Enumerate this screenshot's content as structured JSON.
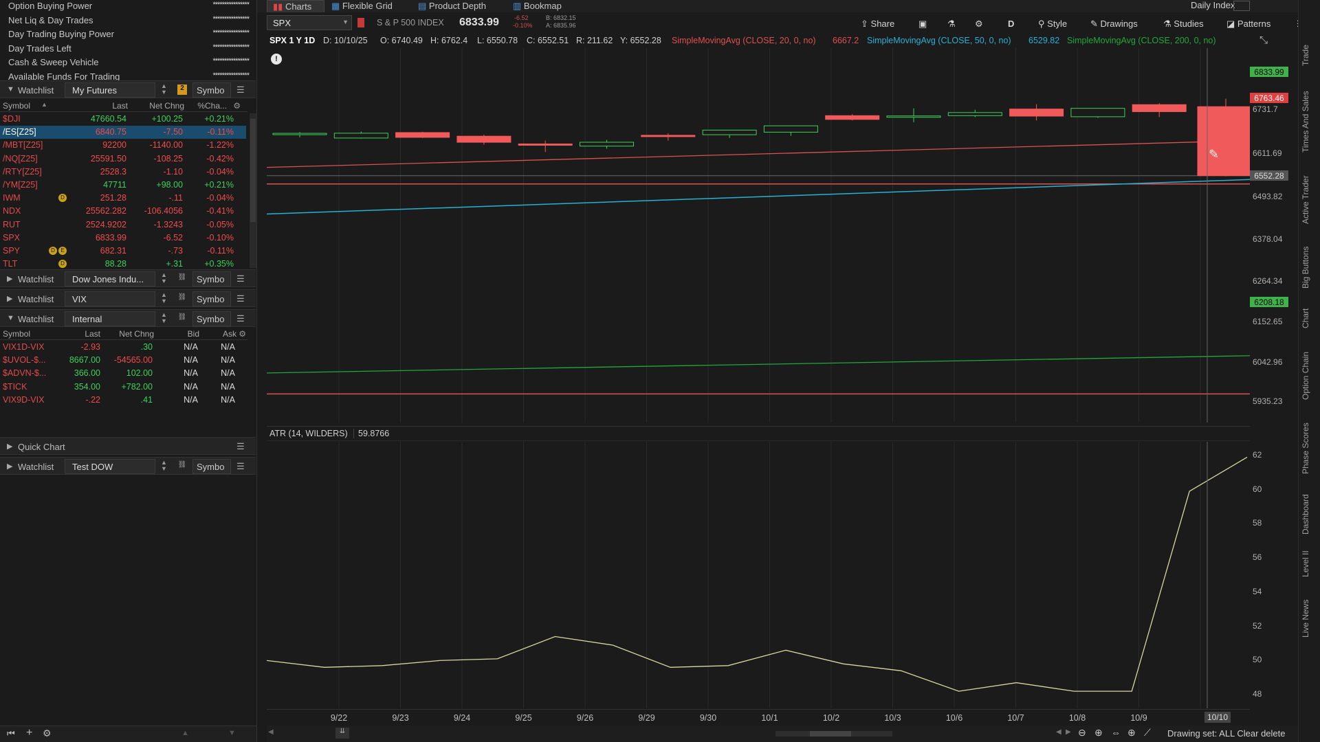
{
  "account": [
    {
      "label": "Option Buying Power",
      "value": "****************"
    },
    {
      "label": "Net Liq & Day Trades",
      "value": "****************"
    },
    {
      "label": "Day Trading Buying Power",
      "value": "****************"
    },
    {
      "label": "Day Trades Left",
      "value": "****************"
    },
    {
      "label": "Cash & Sweep Vehicle",
      "value": "****************"
    },
    {
      "label": "Available Funds For Trading",
      "value": "****************"
    }
  ],
  "wl1": {
    "title": "Watchlist",
    "name": "My Futures",
    "link": "2",
    "symbol": "Symbo",
    "headers": {
      "symbol": "Symbol",
      "last": "Last",
      "chg": "Net Chng",
      "pct": "%Cha..."
    },
    "rows": [
      {
        "s": "$DJI",
        "last": "47660.54",
        "chg": "+100.25",
        "pct": "+0.21%",
        "d": "up"
      },
      {
        "s": "/ES[Z25]",
        "last": "6840.75",
        "chg": "-7.50",
        "pct": "-0.11%",
        "d": "dn"
      },
      {
        "s": "/MBT[Z25]",
        "last": "92200",
        "chg": "-1140.00",
        "pct": "-1.22%",
        "d": "dn"
      },
      {
        "s": "/NQ[Z25]",
        "last": "25591.50",
        "chg": "-108.25",
        "pct": "-0.42%",
        "d": "dn"
      },
      {
        "s": "/RTY[Z25]",
        "last": "2528.3",
        "chg": "-1.10",
        "pct": "-0.04%",
        "d": "dn"
      },
      {
        "s": "/YM[Z25]",
        "last": "47711",
        "chg": "+98.00",
        "pct": "+0.21%",
        "d": "up"
      },
      {
        "s": "IWM",
        "last": "251.28",
        "chg": "-.11",
        "pct": "-0.04%",
        "d": "dn"
      },
      {
        "s": "NDX",
        "last": "25562.282",
        "chg": "-106.4056",
        "pct": "-0.41%",
        "d": "dn"
      },
      {
        "s": "RUT",
        "last": "2524.9202",
        "chg": "-1.3243",
        "pct": "-0.05%",
        "d": "dn"
      },
      {
        "s": "SPX",
        "last": "6833.99",
        "chg": "-6.52",
        "pct": "-0.10%",
        "d": "dn"
      },
      {
        "s": "SPY",
        "last": "682.31",
        "chg": "-.73",
        "pct": "-0.11%",
        "d": "dn"
      },
      {
        "s": "TLT",
        "last": "88.28",
        "chg": "+.31",
        "pct": "+0.35%",
        "d": "up"
      }
    ]
  },
  "wl2": {
    "title": "Watchlist",
    "name": "Dow Jones Indu...",
    "symbol": "Symbo"
  },
  "wl3": {
    "title": "Watchlist",
    "name": "VIX",
    "symbol": "Symbo"
  },
  "wl4": {
    "title": "Watchlist",
    "name": "Internal",
    "symbol": "Symbo",
    "headers": {
      "symbol": "Symbol",
      "last": "Last",
      "chg": "Net Chng",
      "bid": "Bid",
      "ask": "Ask"
    },
    "rows": [
      {
        "s": "VIX1D-VIX",
        "last": "-2.93",
        "chg": ".30",
        "bid": "N/A",
        "ask": "N/A",
        "d": "dn",
        "c": "up"
      },
      {
        "s": "$UVOL-$...",
        "last": "8667.00",
        "chg": "-54565.00",
        "bid": "N/A",
        "ask": "N/A",
        "d": "up",
        "c": "dn"
      },
      {
        "s": "$ADVN-$...",
        "last": "366.00",
        "chg": "102.00",
        "bid": "N/A",
        "ask": "N/A",
        "d": "up",
        "c": "up"
      },
      {
        "s": "$TICK",
        "last": "354.00",
        "chg": "+782.00",
        "bid": "N/A",
        "ask": "N/A",
        "d": "up",
        "c": "up"
      },
      {
        "s": "VIX9D-VIX",
        "last": "-.22",
        "chg": ".41",
        "bid": "N/A",
        "ask": "N/A",
        "d": "dn",
        "c": "up"
      }
    ]
  },
  "quickchart": "Quick Chart",
  "wl5": {
    "title": "Watchlist",
    "name": "Test DOW",
    "symbol": "Symbo"
  },
  "tabs": [
    "Charts",
    "Flexible Grid",
    "Product Depth",
    "Bookmap"
  ],
  "daily_index": "Daily Index",
  "toolbar": {
    "symbol": "SPX",
    "desc": "S & P 500 INDEX",
    "price": "6833.99",
    "chg": "-6.52",
    "pct": "-0.10%",
    "bid": "B: 6832.15",
    "ask": "A: 6835.96",
    "share": "Share",
    "period": "D",
    "style": "Style",
    "drawings": "Drawings",
    "studies": "Studies",
    "patterns": "Patterns"
  },
  "infobar": {
    "sym": "SPX 1 Y 1D",
    "d": "D: 10/10/25",
    "o": "O: 6740.49",
    "h": "H: 6762.4",
    "l": "L: 6550.78",
    "c": "C: 6552.51",
    "r": "R: 211.62",
    "y": "Y: 6552.28",
    "sma20": "SimpleMovingAvg (CLOSE, 20, 0, no)",
    "sma20v": "6667.2",
    "sma50": "SimpleMovingAvg (CLOSE, 50, 0, no)",
    "sma50v": "6529.82",
    "sma200": "SimpleMovingAvg (CLOSE, 200, 0, no)"
  },
  "atr": {
    "label": "ATR (14, WILDERS)",
    "value": "59.8766"
  },
  "price_axis": [
    "6731.7",
    "6611.69",
    "6493.82",
    "6378.04",
    "6264.34",
    "6152.65",
    "6042.96",
    "5935.23"
  ],
  "price_tags": [
    {
      "v": "6833.99",
      "bg": "#3fb24a",
      "fg": "#000"
    },
    {
      "v": "6763.46",
      "bg": "#e04040",
      "fg": "#fff"
    },
    {
      "v": "6552.28",
      "bg": "#555555",
      "fg": "#ddd"
    },
    {
      "v": "6208.18",
      "bg": "#3fb24a",
      "fg": "#000"
    }
  ],
  "atr_axis": [
    "62",
    "60",
    "58",
    "56",
    "54",
    "52",
    "50",
    "48"
  ],
  "dates": [
    "9/22",
    "9/23",
    "9/24",
    "9/25",
    "9/26",
    "9/29",
    "9/30",
    "10/1",
    "10/2",
    "10/3",
    "10/6",
    "10/7",
    "10/8",
    "10/9",
    "10/10"
  ],
  "date_cursor": "10/10",
  "status": "Drawing set: ALL Clear delete",
  "side_tabs": [
    "Trade",
    "Times And Sales",
    "Active Trader",
    "Big Buttons",
    "Chart",
    "Option Chain",
    "Phase Scores",
    "Dashboard",
    "Level II",
    "Live News"
  ],
  "candles": [
    {
      "o": 6664.5,
      "h": 6671.2,
      "l": 6657.0,
      "c": 6667.8
    },
    {
      "o": 6655.0,
      "h": 6672.8,
      "l": 6653.5,
      "c": 6668.2
    },
    {
      "o": 6669.9,
      "h": 6672.0,
      "l": 6655.0,
      "c": 6656.8
    },
    {
      "o": 6660.0,
      "h": 6664.0,
      "l": 6637.0,
      "c": 6643.4
    },
    {
      "o": 6639.0,
      "h": 6648.0,
      "l": 6617.0,
      "c": 6637.5
    },
    {
      "o": 6633.0,
      "h": 6650.0,
      "l": 6626.0,
      "c": 6643.6
    },
    {
      "o": 6662.5,
      "h": 6668.0,
      "l": 6648.0,
      "c": 6661.1
    },
    {
      "o": 6664.0,
      "h": 6674.0,
      "l": 6655.0,
      "c": 6676.6
    },
    {
      "o": 6671.0,
      "h": 6688.0,
      "l": 6661.0,
      "c": 6688.3
    },
    {
      "o": 6716.0,
      "h": 6720.0,
      "l": 6703.0,
      "c": 6705.7
    },
    {
      "o": 6712.0,
      "h": 6736.0,
      "l": 6698.0,
      "c": 6715.2
    },
    {
      "o": 6716.0,
      "h": 6732.0,
      "l": 6712.0,
      "c": 6724.4
    },
    {
      "o": 6734.0,
      "h": 6747.0,
      "l": 6703.0,
      "c": 6714.7
    },
    {
      "o": 6713.0,
      "h": 6736.0,
      "l": 6710.0,
      "c": 6735.9
    },
    {
      "o": 6746.0,
      "h": 6750.0,
      "l": 6712.0,
      "c": 6726.8
    },
    {
      "o": 6740.49,
      "h": 6762.4,
      "l": 6550.78,
      "c": 6552.51
    }
  ],
  "atr_series": [
    50.0,
    49.6,
    49.7,
    50.0,
    50.1,
    51.4,
    50.9,
    49.6,
    49.7,
    50.6,
    49.8,
    49.4,
    48.2,
    48.7,
    48.2,
    48.2,
    59.9,
    61.9
  ],
  "colors": {
    "up": "#3fd15a",
    "down": "#f05a5a",
    "sma20": "#d9534f",
    "sma50": "#2ab0d6",
    "sma200": "#22a83a",
    "atr": "#d8d8a0",
    "bg": "#1b1b1b"
  }
}
